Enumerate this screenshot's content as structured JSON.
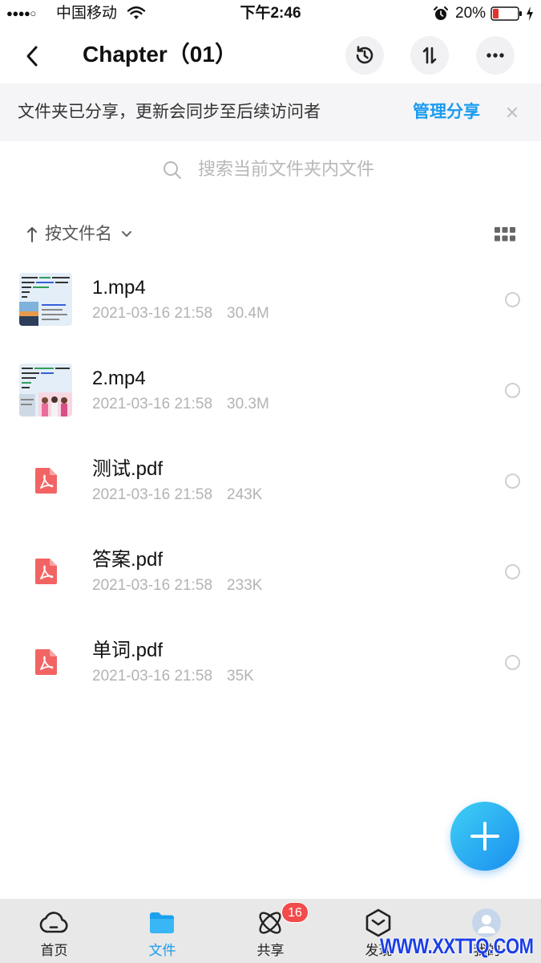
{
  "status_bar": {
    "signal": "●●●●○",
    "carrier": "中国移动",
    "time": "下午2:46",
    "battery_percent": "20%",
    "icons": [
      "wifi-icon",
      "alarm-icon",
      "battery-icon",
      "charging-icon"
    ]
  },
  "header": {
    "title": "Chapter（01）",
    "icons": {
      "back": "chevron-left-icon",
      "history": "history-icon",
      "sort": "sort-icon",
      "more": "more-icon"
    }
  },
  "banner": {
    "message": "文件夹已分享，更新会同步至后续访问者",
    "manage_link": "管理分享",
    "close_icon": "close-icon"
  },
  "search": {
    "placeholder": "搜索当前文件夹内文件",
    "icon": "search-icon"
  },
  "sort": {
    "label": "按文件名",
    "arrow_icon": "arrow-up-icon",
    "dropdown_icon": "chevron-down-icon",
    "view_icon": "grid-view-icon"
  },
  "files": [
    {
      "name": "1.mp4",
      "date": "2021-03-16 21:58",
      "size": "30.4M",
      "icon": "video-thumbnail",
      "selected": false
    },
    {
      "name": "2.mp4",
      "date": "2021-03-16 21:58",
      "size": "30.3M",
      "icon": "video-thumbnail",
      "selected": false
    },
    {
      "name": "测试.pdf",
      "date": "2021-03-16 21:58",
      "size": "243K",
      "icon": "pdf-icon",
      "selected": false
    },
    {
      "name": "答案.pdf",
      "date": "2021-03-16 21:58",
      "size": "233K",
      "icon": "pdf-icon",
      "selected": false
    },
    {
      "name": "单词.pdf",
      "date": "2021-03-16 21:58",
      "size": "35K",
      "icon": "pdf-icon",
      "selected": false
    }
  ],
  "fab": {
    "icon": "plus-icon"
  },
  "tabs": [
    {
      "label": "首页",
      "icon": "cloud-icon",
      "active": false
    },
    {
      "label": "文件",
      "icon": "folder-icon",
      "active": true
    },
    {
      "label": "共享",
      "icon": "share-icon",
      "active": false,
      "badge": "16"
    },
    {
      "label": "发现",
      "icon": "discover-icon",
      "active": false
    },
    {
      "label": "我的",
      "icon": "avatar-icon",
      "active": false
    }
  ],
  "watermark": "WWW.XXTTQ.COM",
  "colors": {
    "accent": "#1a9bef",
    "badge": "#f24b4b",
    "pdf": "#f26464",
    "banner_bg": "#f5f5f7",
    "tabbar_bg": "#e8e8e8",
    "battery_low": "#e5322d"
  }
}
